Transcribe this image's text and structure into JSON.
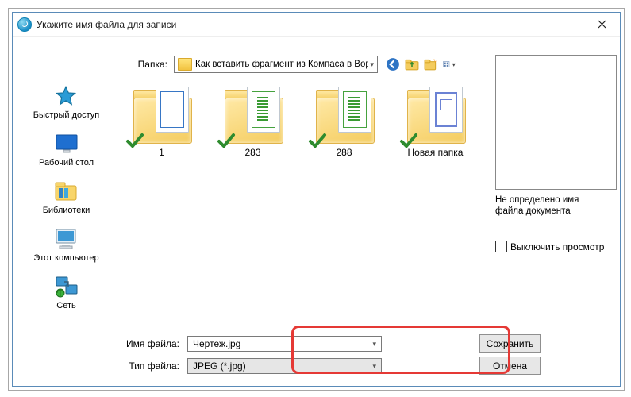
{
  "window": {
    "title": "Укажите имя файла для записи",
    "close": "✕"
  },
  "folderRow": {
    "label": "Папка:",
    "path": "Как вставить фрагмент из Компаса в Вор"
  },
  "sidebar": [
    {
      "label": "Быстрый доступ",
      "icon": "star"
    },
    {
      "label": "Рабочий стол",
      "icon": "desktop"
    },
    {
      "label": "Библиотеки",
      "icon": "libraries"
    },
    {
      "label": "Этот компьютер",
      "icon": "computer"
    },
    {
      "label": "Сеть",
      "icon": "network"
    }
  ],
  "files": [
    {
      "label": "1",
      "ptype": "blue"
    },
    {
      "label": "283",
      "ptype": "green"
    },
    {
      "label": "288",
      "ptype": "green"
    },
    {
      "label": "Новая папка",
      "ptype": "pblue"
    }
  ],
  "preview": {
    "msg": "Не определено имя файла документа",
    "checkbox": "Выключить просмотр"
  },
  "bottom": {
    "fileLabel": "Имя файла:",
    "fileValue": "Чертеж.jpg",
    "typeLabel": "Тип файла:",
    "typeValue": "JPEG (*.jpg)",
    "saveBtn": "Сохранить",
    "cancelBtn": "Отмена"
  }
}
